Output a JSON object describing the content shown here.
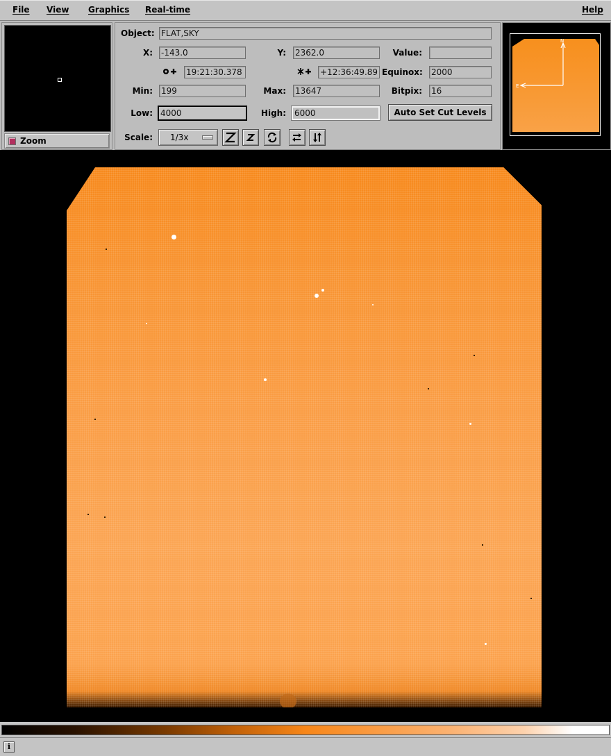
{
  "menu": {
    "file": "File",
    "view": "View",
    "graphics": "Graphics",
    "realtime": "Real-time",
    "help": "Help"
  },
  "zoom": {
    "label": "Zoom",
    "checked": true
  },
  "info": {
    "object_label": "Object:",
    "object_value": "FLAT,SKY",
    "x_label": "X:",
    "x_value": "-143.0",
    "y_label": "Y:",
    "y_value": "2362.0",
    "value_label": "Value:",
    "value_value": "",
    "ra_value": "19:21:30.378",
    "dec_value": "+12:36:49.89",
    "equinox_label": "Equinox:",
    "equinox_value": "2000",
    "min_label": "Min:",
    "min_value": "199",
    "max_label": "Max:",
    "max_value": "13647",
    "bitpix_label": "Bitpix:",
    "bitpix_value": "16",
    "low_label": "Low:",
    "low_value": "4000",
    "high_label": "High:",
    "high_value": "6000",
    "auto_cut_label": "Auto Set Cut Levels",
    "scale_label": "Scale:",
    "scale_value": "1/3x"
  },
  "toolbar_icons": [
    "zoom-in-icon",
    "zoom-out-icon",
    "rotate-icon",
    "flip-x-icon",
    "flip-y-icon"
  ],
  "compass": {
    "north": "N",
    "east": "E"
  },
  "colors": {
    "image_orange": "#f89432",
    "background": "#bdbdbd",
    "image_background": "#000000"
  },
  "status": {
    "icon": "i"
  }
}
